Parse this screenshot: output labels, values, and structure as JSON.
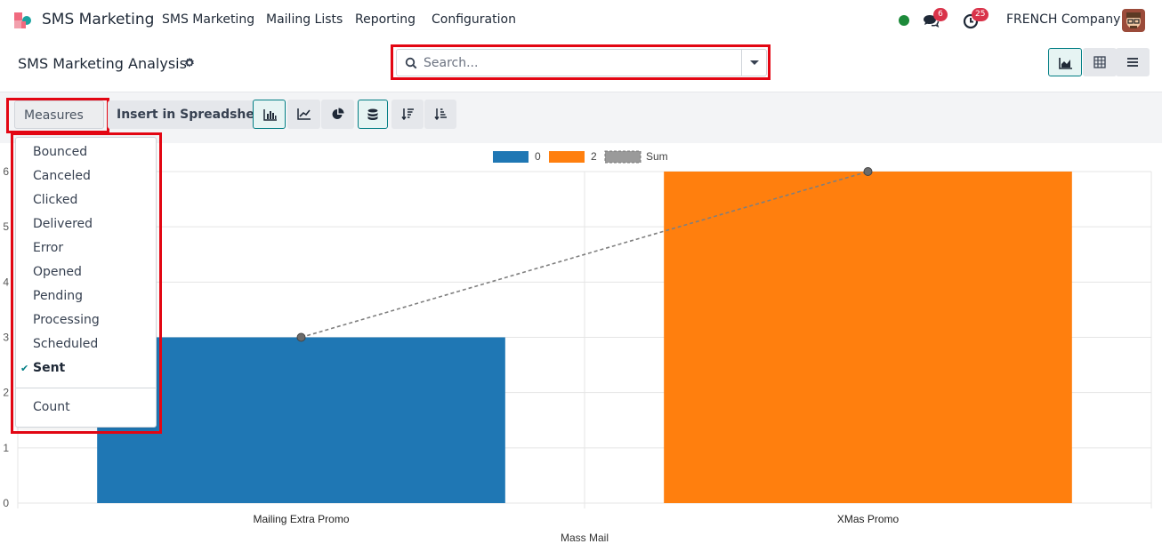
{
  "navbar": {
    "app_name": "SMS Marketing",
    "menu": [
      "SMS Marketing",
      "Mailing Lists",
      "Reporting",
      "Configuration"
    ],
    "messages_count": "6",
    "activities_count": "25",
    "company": "FRENCH Company",
    "status_color": "#1d8a3a"
  },
  "control_panel": {
    "title": "SMS Marketing Analysis",
    "search_placeholder": "Search...",
    "search_value": "",
    "views": [
      "graph",
      "pivot",
      "list"
    ],
    "active_view": "graph"
  },
  "toolbar": {
    "measures_label": "Measures",
    "insert_label": "Insert in Spreadsheet",
    "chart_types": [
      "bar",
      "line",
      "pie"
    ],
    "active_chart_type": "bar",
    "stacked_active": true
  },
  "measures_dropdown": {
    "items": [
      {
        "label": "Bounced",
        "selected": false
      },
      {
        "label": "Canceled",
        "selected": false
      },
      {
        "label": "Clicked",
        "selected": false
      },
      {
        "label": "Delivered",
        "selected": false
      },
      {
        "label": "Error",
        "selected": false
      },
      {
        "label": "Opened",
        "selected": false
      },
      {
        "label": "Pending",
        "selected": false
      },
      {
        "label": "Processing",
        "selected": false
      },
      {
        "label": "Scheduled",
        "selected": false
      },
      {
        "label": "Sent",
        "selected": true
      }
    ],
    "extra_item": {
      "label": "Count",
      "selected": false
    },
    "check_glyph": "✔"
  },
  "chart_data": {
    "type": "bar",
    "title": "",
    "xlabel": "Mass Mail",
    "ylabel": "",
    "categories": [
      "Mailing Extra Promo",
      "XMas Promo"
    ],
    "series": [
      {
        "name": "0",
        "values": [
          3,
          null
        ],
        "color": "#1f77b4"
      },
      {
        "name": "2",
        "values": [
          null,
          6
        ],
        "color": "#ff7f0e"
      }
    ],
    "line": {
      "name": "Sum",
      "values": [
        3,
        6
      ],
      "style": "dashed",
      "color": "#7f7f7f"
    },
    "stacked": true,
    "ylim": [
      0,
      6
    ],
    "yticks": [
      "0",
      "1",
      "2",
      "3",
      "4",
      "5",
      "6"
    ],
    "grid": true,
    "legend": "top-center"
  }
}
